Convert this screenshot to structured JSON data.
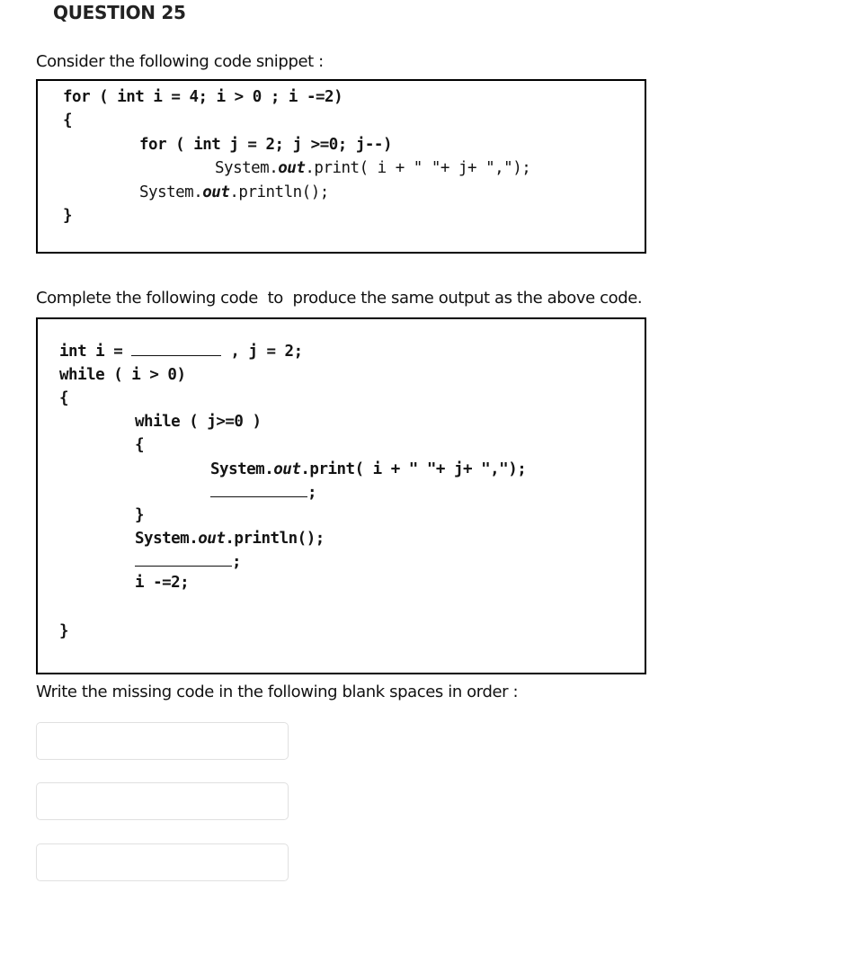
{
  "question": {
    "title": "QUESTION 25",
    "intro": "Consider the following code snippet :",
    "instruction": "Complete the following code  to  produce the same output as the above code.",
    "answer_prompt": "Write the missing code in the following blank spaces in order :"
  },
  "original_code": {
    "line1": "for ( int i = 4; i > 0 ; i -=2)",
    "line2": "{",
    "line3": "for ( int j = 2; j >=0; j--)",
    "line4_pre": "System.",
    "line4_it": "out",
    "line4_post": ".print( i + \" \"+ j+ \",\");",
    "line5_pre": "System.",
    "line5_it": "out",
    "line5_post": ".println();",
    "line6": "}"
  },
  "incomplete_code": {
    "line1_pre": "int i = ",
    "line1_post": " , j = 2;",
    "line2": "while ( i > 0)",
    "line3": "{",
    "line4": "while ( j>=0 )",
    "line5": "{",
    "line6_pre": "System.",
    "line6_it": "out",
    "line6_post": ".print( i + \" \"+ j+ \",\");",
    "line7_post": ";",
    "line8": "}",
    "line9_pre": "System.",
    "line9_it": "out",
    "line9_post": ".println();",
    "line10_post": ";",
    "line11": "i -=2;",
    "line12": "}"
  },
  "answers": [
    {
      "value": "",
      "placeholder": ""
    },
    {
      "value": "",
      "placeholder": ""
    },
    {
      "value": "",
      "placeholder": ""
    }
  ]
}
